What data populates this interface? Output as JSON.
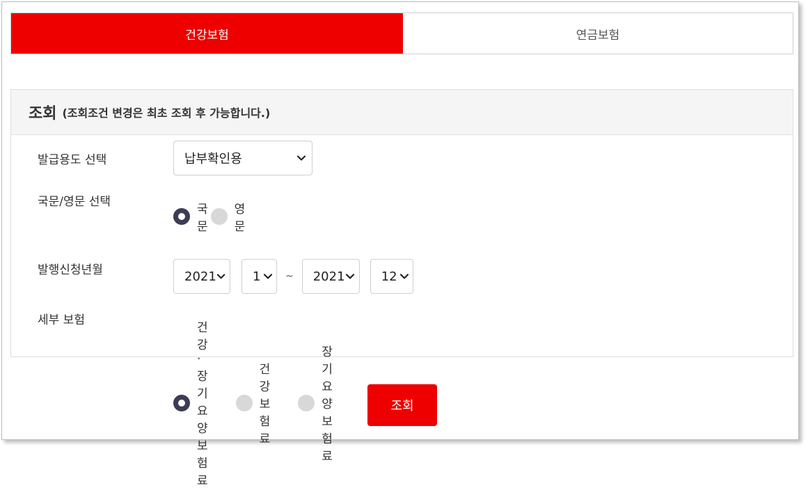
{
  "tabs": [
    {
      "label": "건강보험",
      "active": true
    },
    {
      "label": "연금보험",
      "active": false
    }
  ],
  "panel": {
    "title": "조회",
    "subtitle": "(조회조건 변경은 최초 조회 후 가능합니다.)"
  },
  "form": {
    "purpose": {
      "label": "발급용도 선택",
      "selected": "납부확인용"
    },
    "language": {
      "label": "국문/영문 선택",
      "options": [
        {
          "label": "국문",
          "checked": true
        },
        {
          "label": "영문",
          "checked": false
        }
      ]
    },
    "period": {
      "label": "발행신청년월",
      "from_year": "2021",
      "from_month": "1",
      "separator": "~",
      "to_year": "2021",
      "to_month": "12"
    },
    "detail": {
      "label": "세부 보험",
      "options": [
        {
          "label": "건강·장기요양보험료",
          "checked": true
        },
        {
          "label": "건강보험료",
          "checked": false
        },
        {
          "label": "장기요양보험료",
          "checked": false
        }
      ]
    }
  },
  "submit_label": "조회",
  "colors": {
    "accent": "#ee0000",
    "radio_on": "#3c3c54",
    "radio_off": "#d8d8d8"
  }
}
